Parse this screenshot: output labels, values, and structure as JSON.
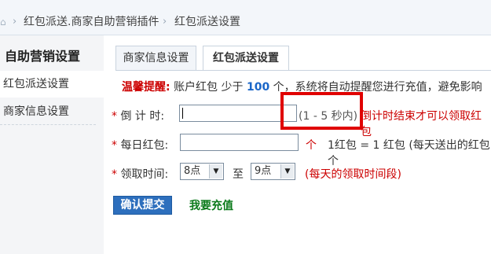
{
  "breadcrumb": {
    "items": [
      "红包派送.商家自助营销插件",
      "红包派送设置"
    ]
  },
  "sidebar": {
    "title": "自助营销设置",
    "items": [
      {
        "label": "红包派送设置",
        "active": true
      },
      {
        "label": "商家信息设置",
        "active": false
      }
    ]
  },
  "tabs": [
    {
      "label": "商家信息设置",
      "active": false
    },
    {
      "label": "红包派送设置",
      "active": true
    }
  ],
  "notice": {
    "title": "温馨提醒:",
    "text_before": "账户红包 少于",
    "amount": "100",
    "text_after": "个，系统将自动提醒您进行充值，避免影响"
  },
  "form": {
    "countdown": {
      "label": "倒 计 时:",
      "value": "",
      "hint": "(1 - 5 秒内)",
      "note": "倒计时结束才可以领取红包"
    },
    "daily": {
      "label": "每日红包:",
      "value": "",
      "unit": "个",
      "note": "1红包 = 1 红包 (每天送出的红包个"
    },
    "time": {
      "label": "领取时间:",
      "from": "8点",
      "separator": "至",
      "to": "9点",
      "note": "(每天的领取时间段)"
    },
    "required_mark": "*"
  },
  "actions": {
    "submit": "确认提交",
    "recharge": "我要充值"
  },
  "colors": {
    "accent": "#2d6fbd",
    "warning": "#cc0000",
    "link": "#0a7a1a"
  }
}
